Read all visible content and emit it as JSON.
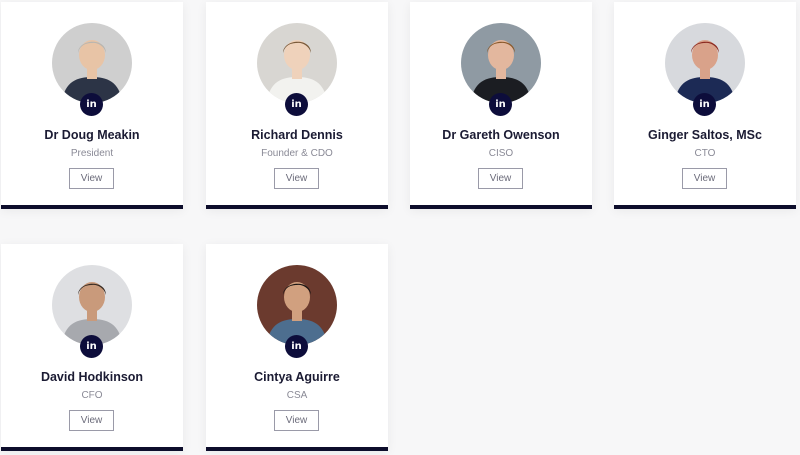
{
  "team": [
    {
      "name": "Dr Doug Meakin",
      "role": "President",
      "linkedin_icon": "linkedin-icon",
      "view_label": "View",
      "photo": {
        "bg": "#cfcfcf",
        "skin": "#e8c4a6",
        "hair": "#b9b6b0",
        "clothing": "#2c3446"
      }
    },
    {
      "name": "Richard Dennis",
      "role": "Founder & CDO",
      "linkedin_icon": "linkedin-icon",
      "view_label": "View",
      "photo": {
        "bg": "#d8d6d2",
        "skin": "#efd2bb",
        "hair": "#7a5a3a",
        "clothing": "#f2f2ef"
      }
    },
    {
      "name": "Dr Gareth Owenson",
      "role": "CISO",
      "linkedin_icon": "linkedin-icon",
      "view_label": "View",
      "photo": {
        "bg": "#8f9aa3",
        "skin": "#e3b79e",
        "hair": "#8a5a2c",
        "clothing": "#1b1d22"
      }
    },
    {
      "name": "Ginger Saltos, MSc",
      "role": "CTO",
      "linkedin_icon": "linkedin-icon",
      "view_label": "View",
      "photo": {
        "bg": "#d7d9dd",
        "skin": "#d9a28a",
        "hair": "#8c2b22",
        "clothing": "#1c2a55"
      }
    },
    {
      "name": "David Hodkinson",
      "role": "CFO",
      "linkedin_icon": "linkedin-icon",
      "view_label": "View",
      "photo": {
        "bg": "#dedfe2",
        "skin": "#c99a7b",
        "hair": "#3a2d25",
        "clothing": "#a7a9ae"
      }
    },
    {
      "name": "Cintya Aguirre",
      "role": "CSA",
      "linkedin_icon": "linkedin-icon",
      "view_label": "View",
      "photo": {
        "bg": "#6b3a2e",
        "skin": "#d1a07f",
        "hair": "#1d1614",
        "clothing": "#4d6e8f"
      }
    }
  ]
}
